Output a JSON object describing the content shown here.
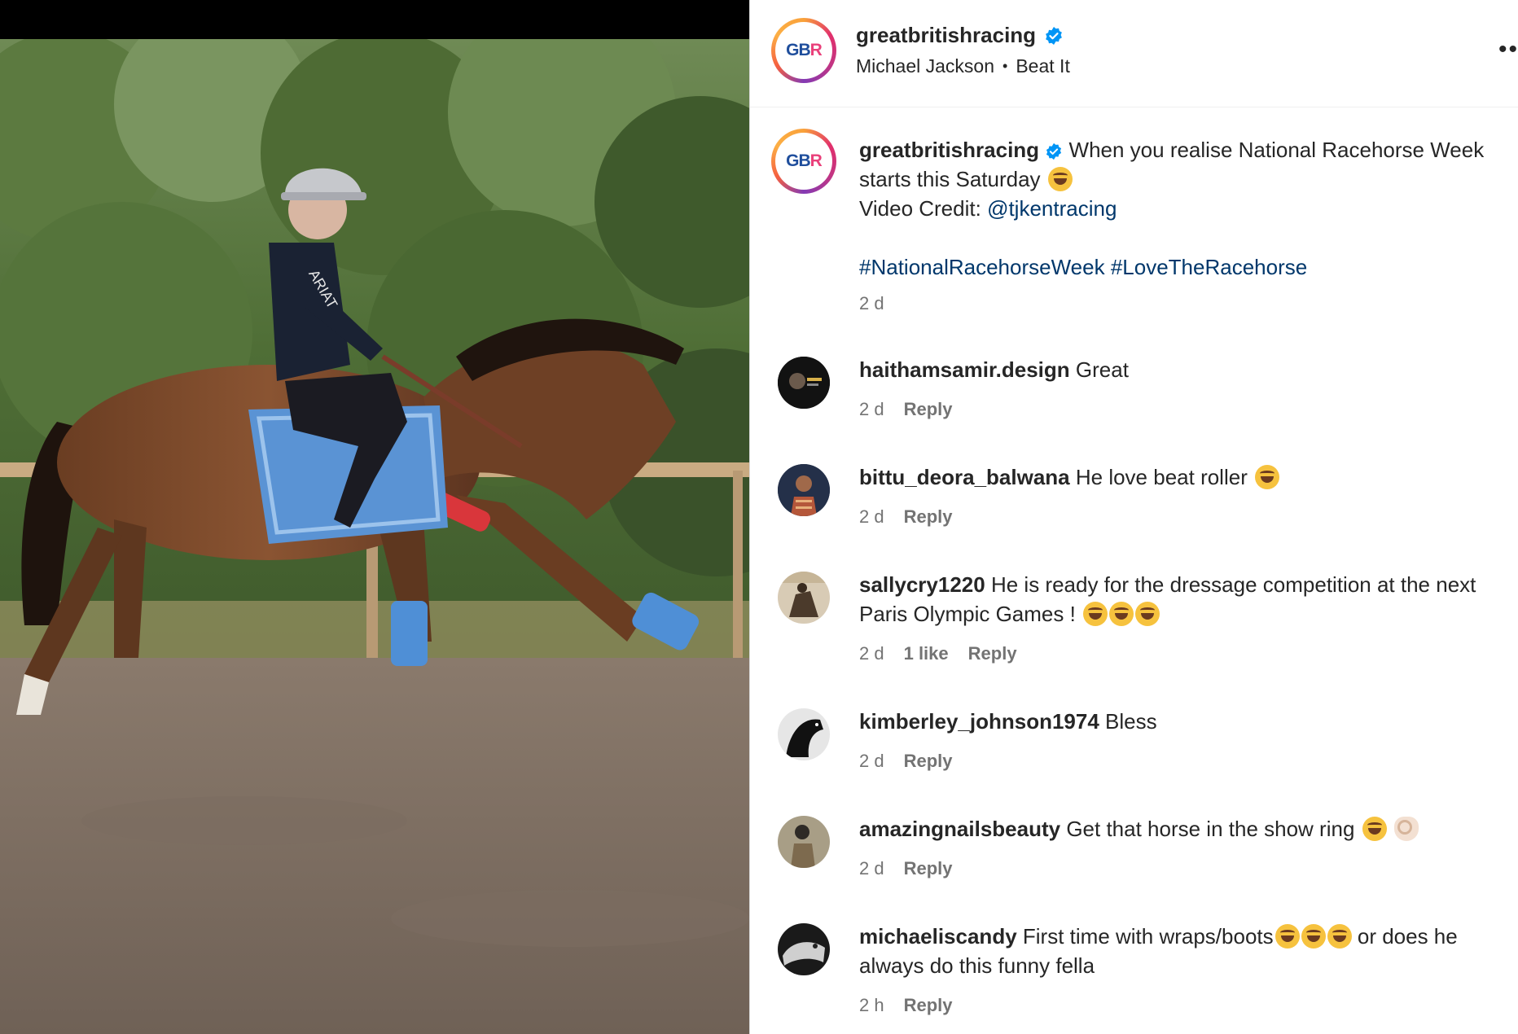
{
  "post": {
    "username": "greatbritishracing",
    "avatar_text": "GB",
    "avatar_text_accent": "R",
    "audio_artist": "Michael Jackson",
    "audio_separator": "•",
    "audio_track": "Beat It",
    "more_label": "••",
    "caption_line1": "When you realise National Racehorse Week starts this Saturday",
    "caption_credit_label": "Video Credit: ",
    "caption_credit_handle": "@tjkentracing",
    "hashtag_1": "#NationalRacehorseWeek",
    "hashtag_2": "#LoveTheRacehorse",
    "time": "2 d"
  },
  "comments": [
    {
      "username": "haithamsamir.design",
      "text": "Great",
      "time": "2 d",
      "likes": "",
      "reply": "Reply"
    },
    {
      "username": "bittu_deora_balwana",
      "text": "He love beat roller",
      "time": "2 d",
      "likes": "",
      "reply": "Reply"
    },
    {
      "username": "sallycry1220",
      "text": "He is ready for the dressage competition at the next Paris Olympic Games !",
      "time": "2 d",
      "likes": "1 like",
      "reply": "Reply"
    },
    {
      "username": "kimberley_johnson1974",
      "text": "Bless",
      "time": "2 d",
      "likes": "",
      "reply": "Reply"
    },
    {
      "username": "amazingnailsbeauty",
      "text": "Get that horse in the show ring",
      "time": "2 d",
      "likes": "",
      "reply": "Reply"
    },
    {
      "username": "michaeliscandy",
      "text": "First time with wraps/boots",
      "text_after": " or does he always do this funny fella",
      "time": "2 h",
      "likes": "",
      "reply": "Reply"
    }
  ],
  "colors": {
    "link": "#00376b",
    "meta": "#737373",
    "brand_blue": "#1f4e9c",
    "brand_pink": "#e9407a",
    "verified": "#0095f6"
  }
}
